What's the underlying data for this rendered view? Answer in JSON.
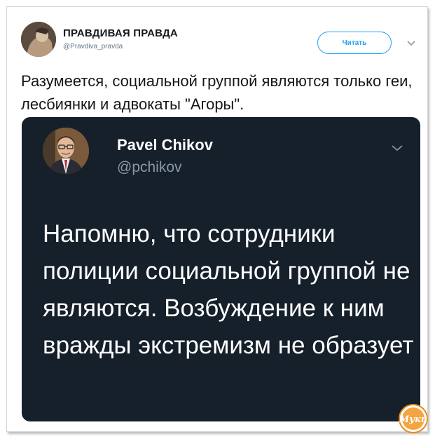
{
  "tweet": {
    "author_name": "ПРАВДИВАЯ ПРАВДА",
    "author_handle": "@Pravdiva_pravda",
    "follow_label": "Читать",
    "text": "Разумеется, социальной группой являются только геи, лесбиянки и адвокаты \"Агоры\"."
  },
  "embedded": {
    "author_name": "Pavel Chikov",
    "author_handle": "@pchikov",
    "body": "Напомню, что сотрудники полиции социальной группой не являются. Возбуждение к ним вражды экстремизм не образует"
  },
  "watermark": {
    "text": "Муки"
  },
  "colors": {
    "accent": "#1da1f2",
    "card_bg": "#15202b",
    "watermark": "#e8891d"
  },
  "icons": {
    "menu": "chevron-down-icon",
    "embed_menu": "chevron-down-icon"
  }
}
